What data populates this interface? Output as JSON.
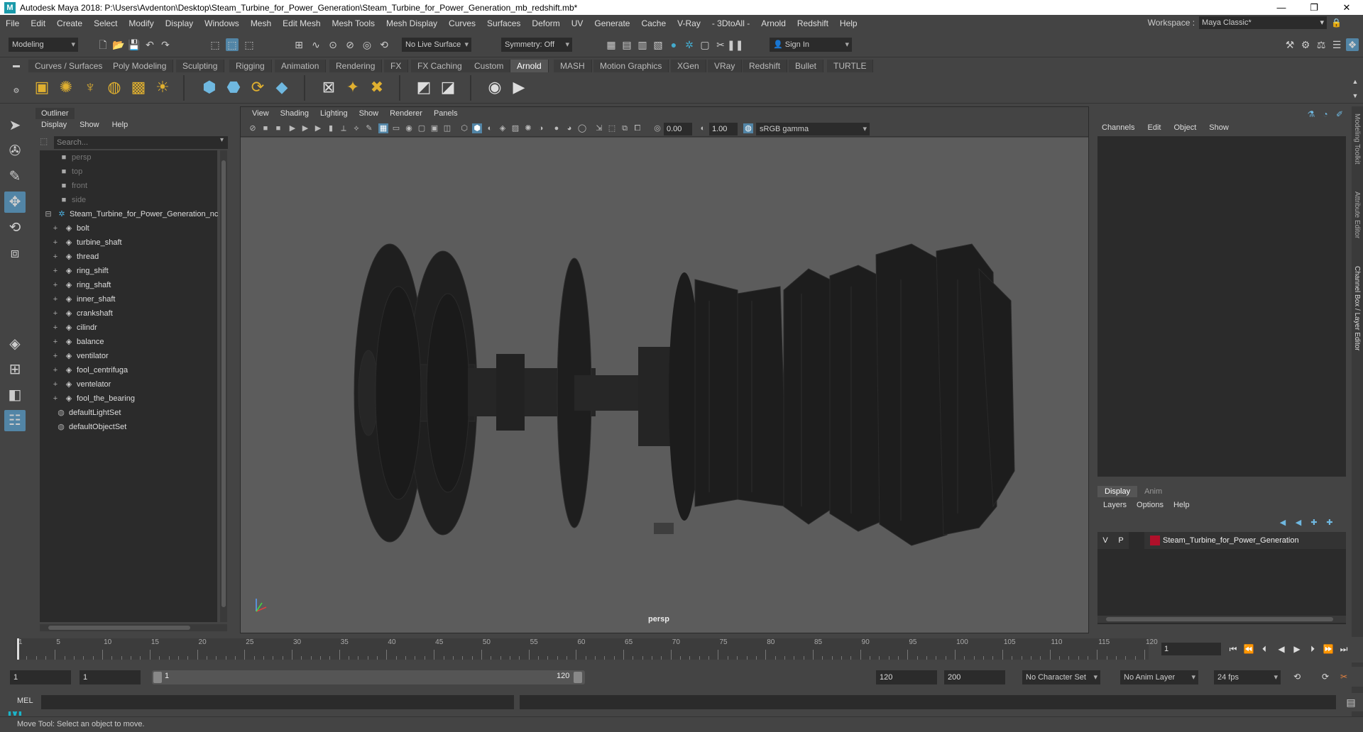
{
  "window": {
    "title": "Autodesk Maya 2018: P:\\Users\\Avdenton\\Desktop\\Steam_Turbine_for_Power_Generation\\Steam_Turbine_for_Power_Generation_mb_redshift.mb*",
    "minimize": "—",
    "maximize": "❐",
    "close": "✕"
  },
  "menu": [
    "File",
    "Edit",
    "Create",
    "Select",
    "Modify",
    "Display",
    "Windows",
    "Mesh",
    "Edit Mesh",
    "Mesh Tools",
    "Mesh Display",
    "Curves",
    "Surfaces",
    "Deform",
    "UV",
    "Generate",
    "Cache",
    "V-Ray",
    "- 3DtoAll -",
    "Arnold",
    "Redshift",
    "Help"
  ],
  "workspace": {
    "label": "Workspace :",
    "value": "Maya Classic*"
  },
  "status": {
    "mode": "Modeling",
    "live_surface": "No Live Surface",
    "symmetry": "Symmetry: Off",
    "sign_in": "Sign In"
  },
  "shelf_tabs": [
    "Curves / Surfaces",
    "Poly Modeling",
    "Sculpting",
    "Rigging",
    "Animation",
    "Rendering",
    "FX",
    "FX Caching",
    "Custom",
    "Arnold",
    "MASH",
    "Motion Graphics",
    "XGen",
    "VRay",
    "Redshift",
    "Bullet",
    "TURTLE"
  ],
  "active_shelf": "Arnold",
  "outliner": {
    "title": "Outliner",
    "menu": [
      "Display",
      "Show",
      "Help"
    ],
    "search_placeholder": "Search...",
    "cameras": [
      "persp",
      "top",
      "front",
      "side"
    ],
    "root_group": "Steam_Turbine_for_Power_Generation_nc",
    "children": [
      "bolt",
      "turbine_shaft",
      "thread",
      "ring_shift",
      "ring_shaft",
      "inner_shaft",
      "crankshaft",
      "cilindr",
      "balance",
      "ventilator",
      "fool_centrifuga",
      "ventelator",
      "fool_the_bearing"
    ],
    "sets": [
      "defaultLightSet",
      "defaultObjectSet"
    ]
  },
  "viewport": {
    "menu": [
      "View",
      "Shading",
      "Lighting",
      "Show",
      "Renderer",
      "Panels"
    ],
    "exposure": "0.00",
    "gamma": "1.00",
    "color_space": "sRGB gamma",
    "camera": "persp"
  },
  "channel_box": {
    "menu": [
      "Channels",
      "Edit",
      "Object",
      "Show"
    ],
    "layer_tabs": [
      "Display",
      "Anim"
    ],
    "layer_menu": [
      "Layers",
      "Options",
      "Help"
    ],
    "layer": {
      "v": "V",
      "p": "P",
      "name": "Steam_Turbine_for_Power_Generation",
      "color": "#b0102a"
    }
  },
  "side_tabs": [
    "Modeling Toolkit",
    "Attribute Editor",
    "Channel Box / Layer Editor"
  ],
  "timeline": {
    "ticks": [
      "1",
      "5",
      "10",
      "15",
      "20",
      "25",
      "30",
      "35",
      "40",
      "45",
      "50",
      "55",
      "60",
      "65",
      "70",
      "75",
      "80",
      "85",
      "90",
      "95",
      "100",
      "105",
      "110",
      "115",
      "120"
    ],
    "current_frame": "1"
  },
  "range": {
    "start": "1",
    "playback_start": "1",
    "slider_start": "1",
    "slider_end": "120",
    "playback_end": "120",
    "end": "200",
    "character_set": "No Character Set",
    "anim_layer": "No Anim Layer",
    "fps": "24 fps"
  },
  "command": {
    "label": "MEL"
  },
  "help_line": "Move Tool: Select an object to move."
}
